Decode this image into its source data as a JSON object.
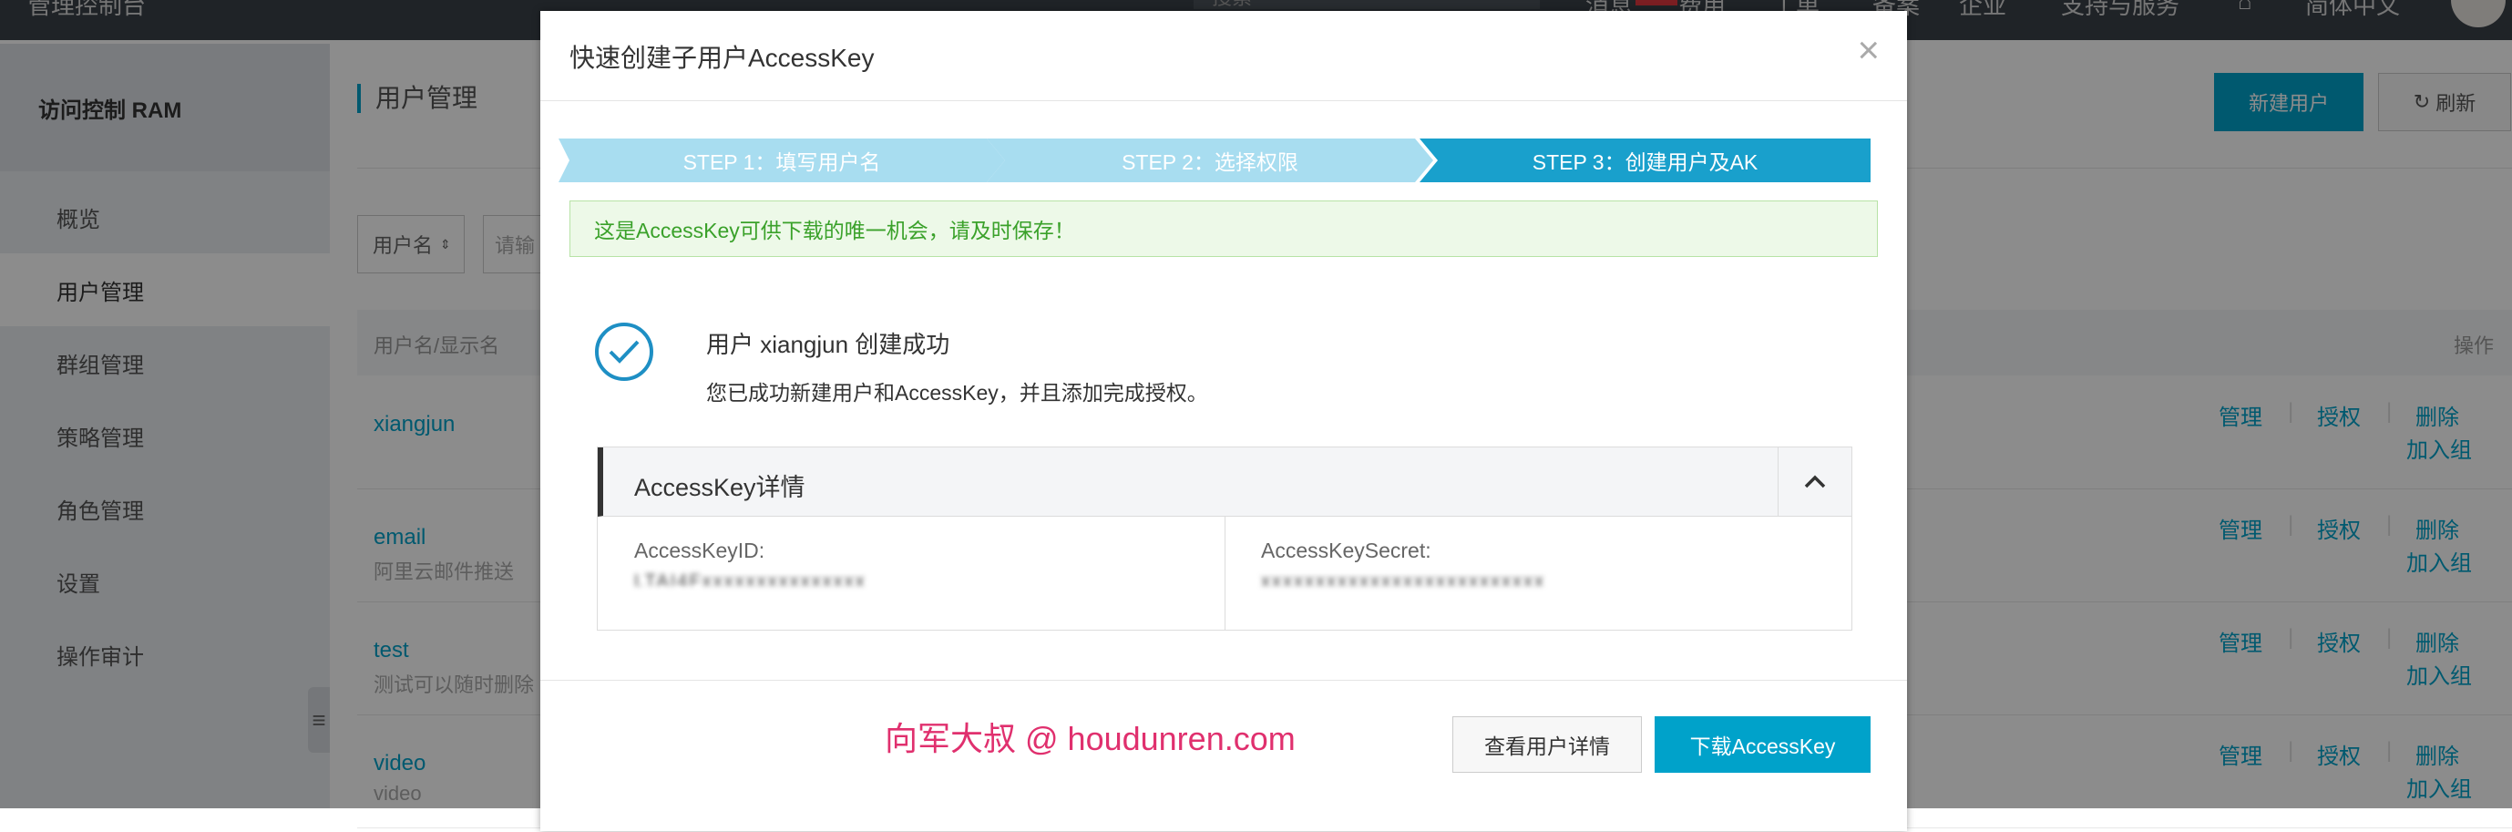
{
  "topbar": {
    "brand": "管理控制台",
    "search_placeholder": "搜索",
    "nav": [
      "消息",
      "费用",
      "工单",
      "备案",
      "企业",
      "支持与服务",
      "简体中文"
    ]
  },
  "sidebar": {
    "title": "访问控制 RAM",
    "items": [
      {
        "label": "概览"
      },
      {
        "label": "用户管理"
      },
      {
        "label": "群组管理"
      },
      {
        "label": "策略管理"
      },
      {
        "label": "角色管理"
      },
      {
        "label": "设置"
      },
      {
        "label": "操作审计"
      }
    ]
  },
  "main": {
    "page_title": "用户管理",
    "new_user_label": "新建用户",
    "refresh_label": "刷新",
    "filter_select": "用户名",
    "filter_placeholder": "请输",
    "table": {
      "col_user": "用户名/显示名",
      "col_ops": "操作",
      "rows": [
        {
          "name": "xiangjun",
          "display": ""
        },
        {
          "name": "email",
          "display": "阿里云邮件推送"
        },
        {
          "name": "test",
          "display": "测试可以随时删除"
        },
        {
          "name": "video",
          "display": "video"
        }
      ],
      "op_manage": "管理",
      "op_grant": "授权",
      "op_delete": "删除",
      "op_join_group": "加入组",
      "sep": "|"
    }
  },
  "modal": {
    "title": "快速创建子用户AccessKey",
    "steps": [
      {
        "label": "STEP 1：填写用户名"
      },
      {
        "label": "STEP 2：选择权限"
      },
      {
        "label": "STEP 3：创建用户及AK"
      }
    ],
    "notice": "这是AccessKey可供下载的唯一机会，请及时保存！",
    "success_title": "用户 xiangjun 创建成功",
    "success_desc": "您已成功新建用户和AccessKey，并且添加完成授权。",
    "ak_section_title": "AccessKey详情",
    "ak_id_label": "AccessKeyID:",
    "ak_id_value": "LTAI4Fxxxxxxxxxxxxxxx",
    "ak_secret_label": "AccessKeySecret:",
    "ak_secret_value": "xxxxxxxxxxxxxxxxxxxxxxxxxx",
    "watermark": "向军大叔 @ houdunren.com",
    "detail_button": "查看用户详情",
    "download_button": "下载AccessKey"
  },
  "colors": {
    "primary": "#00a2ca",
    "step_active": "#19a0cc",
    "step_inactive": "#a8ddf0",
    "success_green": "#3aa12a",
    "watermark": "#e0306e"
  }
}
